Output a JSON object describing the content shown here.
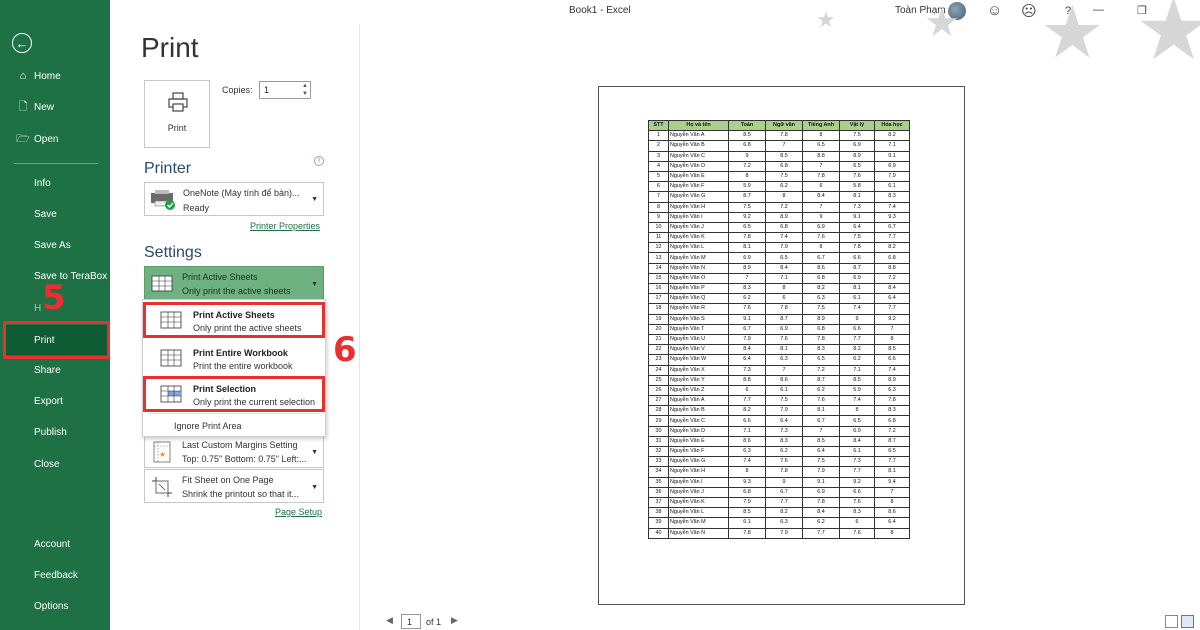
{
  "window": {
    "title": "Book1  -  Excel",
    "user_name": "Toàn Phạm",
    "help": "?"
  },
  "sidebar": {
    "back_label": "←",
    "items": [
      {
        "label": "Home",
        "icon": "home-icon",
        "glyph": "⌂"
      },
      {
        "label": "New",
        "icon": "new-file-icon",
        "glyph": "🗋"
      },
      {
        "label": "Open",
        "icon": "open-folder-icon",
        "glyph": "🗁"
      },
      {
        "label": "Info"
      },
      {
        "label": "Save"
      },
      {
        "label": "Save As"
      },
      {
        "label": "Save to TeraBox"
      },
      {
        "label": "H"
      },
      {
        "label": "Print"
      },
      {
        "label": "Share"
      },
      {
        "label": "Export"
      },
      {
        "label": "Publish"
      },
      {
        "label": "Close"
      },
      {
        "label": "Account"
      },
      {
        "label": "Feedback"
      },
      {
        "label": "Options"
      }
    ],
    "active": "Print"
  },
  "callouts": {
    "step_5": "5",
    "step_6": "6"
  },
  "print": {
    "title": "Print",
    "print_button_label": "Print",
    "copies_label": "Copies:",
    "copies_value": "1"
  },
  "printer": {
    "heading": "Printer",
    "name": "OneNote (Máy tính để bàn)...",
    "status": "Ready",
    "properties_link": "Printer Properties"
  },
  "settings": {
    "heading": "Settings",
    "selected": {
      "title": "Print Active Sheets",
      "subtitle": "Only print the active sheets"
    },
    "dropdown": [
      {
        "title": "Print Active Sheets",
        "subtitle": "Only print the active sheets"
      },
      {
        "title": "Print Entire Workbook",
        "subtitle": "Print the entire workbook"
      },
      {
        "title": "Print Selection",
        "subtitle": "Only print the current selection"
      }
    ],
    "ignore_print_area": "Ignore Print Area",
    "margins": {
      "title": "Last Custom Margins Setting",
      "subtitle": "Top: 0.75\" Bottom: 0.75\" Left:..."
    },
    "scaling": {
      "title": "Fit Sheet on One Page",
      "subtitle": "Shrink the printout so that it..."
    },
    "page_setup_link": "Page Setup"
  },
  "preview": {
    "headers": [
      "STT",
      "Họ và tên",
      "Toán",
      "Ngữ văn",
      "Tiếng Anh",
      "Vật lý",
      "Hóa học"
    ],
    "rows": [
      [
        "1",
        "Nguyễn Văn A",
        "8.5",
        "7.8",
        "8",
        "7.5",
        "8.2"
      ],
      [
        "2",
        "Nguyễn Văn B",
        "6.8",
        "7",
        "6.5",
        "6.9",
        "7.1"
      ],
      [
        "3",
        "Nguyễn Văn C",
        "9",
        "8.5",
        "8.8",
        "8.9",
        "9.1"
      ],
      [
        "4",
        "Nguyễn Văn D",
        "7.2",
        "6.8",
        "7",
        "6.5",
        "6.9"
      ],
      [
        "5",
        "Nguyễn Văn E",
        "8",
        "7.5",
        "7.8",
        "7.6",
        "7.9"
      ],
      [
        "6",
        "Nguyễn Văn F",
        "5.9",
        "6.2",
        "6",
        "5.8",
        "6.1"
      ],
      [
        "7",
        "Nguyễn Văn G",
        "8.7",
        "8",
        "8.4",
        "8.1",
        "8.3"
      ],
      [
        "8",
        "Nguyễn Văn H",
        "7.5",
        "7.2",
        "7",
        "7.3",
        "7.4"
      ],
      [
        "9",
        "Nguyễn Văn I",
        "9.2",
        "8.9",
        "9",
        "9.1",
        "9.3"
      ],
      [
        "10",
        "Nguyễn Văn J",
        "6.5",
        "6.8",
        "6.9",
        "6.4",
        "6.7"
      ],
      [
        "11",
        "Nguyễn Văn K",
        "7.8",
        "7.4",
        "7.6",
        "7.5",
        "7.7"
      ],
      [
        "12",
        "Nguyễn Văn L",
        "8.1",
        "7.9",
        "8",
        "7.8",
        "8.2"
      ],
      [
        "13",
        "Nguyễn Văn M",
        "6.9",
        "6.5",
        "6.7",
        "6.6",
        "6.8"
      ],
      [
        "14",
        "Nguyễn Văn N",
        "8.9",
        "8.4",
        "8.6",
        "8.7",
        "8.8"
      ],
      [
        "15",
        "Nguyễn Văn O",
        "7",
        "7.1",
        "6.8",
        "6.9",
        "7.2"
      ],
      [
        "16",
        "Nguyễn Văn P",
        "8.3",
        "8",
        "8.2",
        "8.1",
        "8.4"
      ],
      [
        "17",
        "Nguyễn Văn Q",
        "6.2",
        "6",
        "6.3",
        "6.1",
        "6.4"
      ],
      [
        "18",
        "Nguyễn Văn R",
        "7.6",
        "7.8",
        "7.5",
        "7.4",
        "7.7"
      ],
      [
        "19",
        "Nguyễn Văn S",
        "9.1",
        "8.7",
        "8.9",
        "9",
        "9.2"
      ],
      [
        "20",
        "Nguyễn Văn T",
        "6.7",
        "6.9",
        "6.8",
        "6.6",
        "7"
      ],
      [
        "21",
        "Nguyễn Văn U",
        "7.9",
        "7.6",
        "7.8",
        "7.7",
        "8"
      ],
      [
        "22",
        "Nguyễn Văn V",
        "8.4",
        "8.1",
        "8.3",
        "8.2",
        "8.5"
      ],
      [
        "23",
        "Nguyễn Văn W",
        "6.4",
        "6.3",
        "6.5",
        "6.2",
        "6.6"
      ],
      [
        "24",
        "Nguyễn Văn X",
        "7.3",
        "7",
        "7.2",
        "7.1",
        "7.4"
      ],
      [
        "25",
        "Nguyễn Văn Y",
        "8.8",
        "8.6",
        "8.7",
        "8.5",
        "8.9"
      ],
      [
        "26",
        "Nguyễn Văn Z",
        "6",
        "6.1",
        "6.2",
        "5.9",
        "6.3"
      ],
      [
        "27",
        "Nguyễn Văn A",
        "7.7",
        "7.5",
        "7.6",
        "7.4",
        "7.8"
      ],
      [
        "28",
        "Nguyễn Văn B",
        "8.2",
        "7.9",
        "8.1",
        "8",
        "8.3"
      ],
      [
        "29",
        "Nguyễn Văn C",
        "6.6",
        "6.4",
        "6.7",
        "6.5",
        "6.8"
      ],
      [
        "30",
        "Nguyễn Văn D",
        "7.1",
        "7.3",
        "7",
        "6.9",
        "7.2"
      ],
      [
        "31",
        "Nguyễn Văn E",
        "8.6",
        "8.3",
        "8.5",
        "8.4",
        "8.7"
      ],
      [
        "32",
        "Nguyễn Văn F",
        "6.3",
        "6.2",
        "6.4",
        "6.1",
        "6.5"
      ],
      [
        "33",
        "Nguyễn Văn G",
        "7.4",
        "7.6",
        "7.5",
        "7.3",
        "7.7"
      ],
      [
        "34",
        "Nguyễn Văn H",
        "8",
        "7.8",
        "7.9",
        "7.7",
        "8.1"
      ],
      [
        "35",
        "Nguyễn Văn I",
        "9.3",
        "9",
        "9.1",
        "9.2",
        "9.4"
      ],
      [
        "36",
        "Nguyễn Văn J",
        "6.8",
        "6.7",
        "6.9",
        "6.6",
        "7"
      ],
      [
        "37",
        "Nguyễn Văn K",
        "7.9",
        "7.7",
        "7.8",
        "7.6",
        "8"
      ],
      [
        "38",
        "Nguyễn Văn L",
        "8.5",
        "8.2",
        "8.4",
        "8.3",
        "8.6"
      ],
      [
        "39",
        "Nguyễn Văn M",
        "6.1",
        "6.3",
        "6.2",
        "6",
        "6.4"
      ],
      [
        "40",
        "Nguyễn Văn N",
        "7.8",
        "7.9",
        "7.7",
        "7.6",
        "8"
      ]
    ]
  },
  "pager": {
    "current_page": "1",
    "of_label": "of 1"
  },
  "colors": {
    "sidebar": "#1e7145",
    "active": "#0e5c33",
    "callout": "#e8312f",
    "header_fill": "#a9d18e",
    "link": "#1e7145"
  }
}
